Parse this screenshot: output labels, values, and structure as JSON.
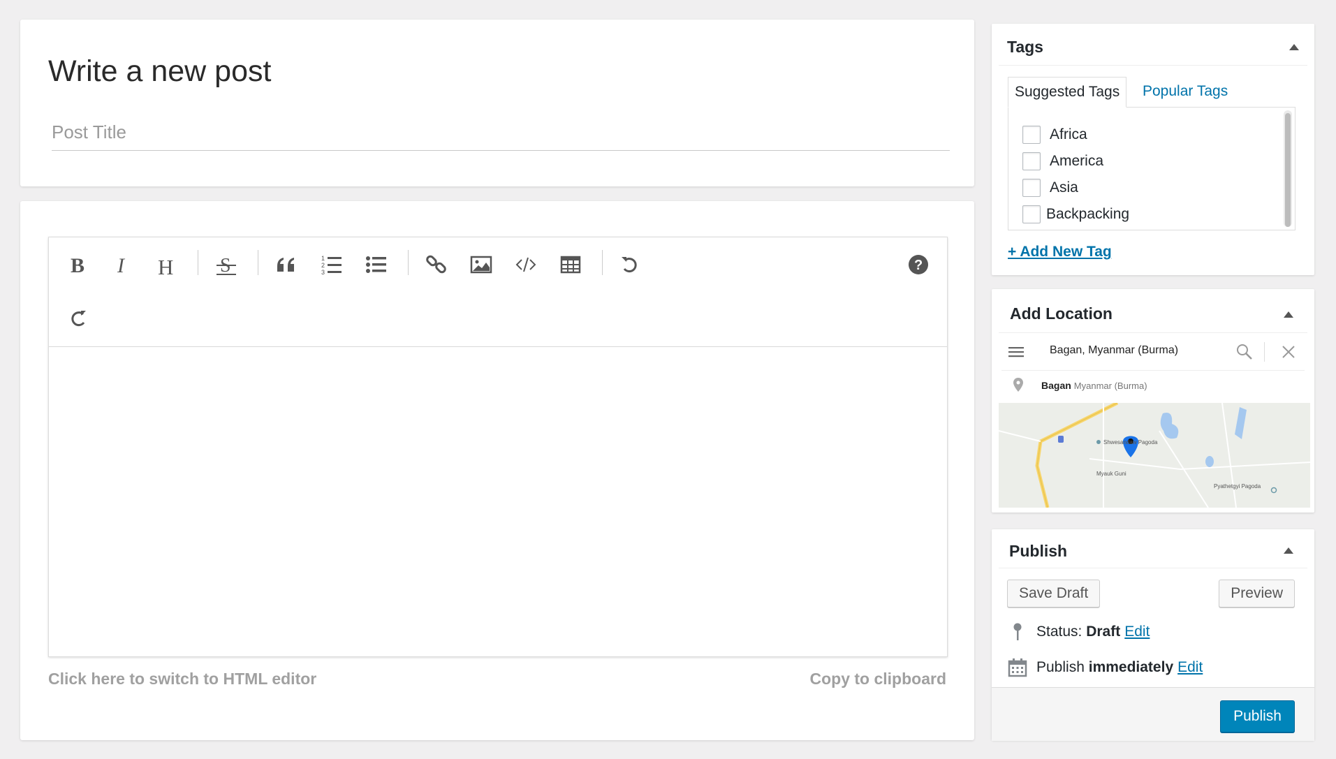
{
  "post": {
    "heading": "Write a new post",
    "title_placeholder": "Post Title",
    "title_value": ""
  },
  "editor": {
    "toolbar_icons": [
      "bold-icon",
      "italic-icon",
      "heading-icon",
      "strikethrough-icon",
      "quote-icon",
      "ordered-list-icon",
      "unordered-list-icon",
      "link-icon",
      "image-icon",
      "code-icon",
      "table-icon",
      "undo-icon",
      "redo-icon",
      "help-icon"
    ],
    "switch_html_label": "Click here to switch to HTML editor",
    "copy_label": "Copy to clipboard"
  },
  "tags_box": {
    "title": "Tags",
    "tabs": [
      {
        "label": "Suggested Tags"
      },
      {
        "label": "Popular Tags"
      }
    ],
    "tags": [
      {
        "label": "Africa",
        "checked": false
      },
      {
        "label": "America",
        "checked": false
      },
      {
        "label": "Asia",
        "checked": false
      },
      {
        "label": "Backpacking",
        "checked": false
      }
    ],
    "add_new_label": "+ Add New Tag"
  },
  "location_box": {
    "title": "Add Location",
    "search_value": "Bagan, Myanmar (Burma)",
    "suggestion": {
      "name": "Bagan",
      "region": "Myanmar (Burma)"
    },
    "map_labels": [
      "Shwesandaw Pagoda",
      "Myauk Guni",
      "Pyathetgyi Pagoda"
    ]
  },
  "publish_box": {
    "title": "Publish",
    "save_draft_label": "Save Draft",
    "preview_label": "Preview",
    "status_label": "Status:",
    "status_value": "Draft",
    "publish_label": "Publish",
    "publish_when": "immediately",
    "edit_label": "Edit",
    "publish_button_label": "Publish"
  },
  "colors": {
    "accent": "#0073aa",
    "primary_button": "#0085ba",
    "map_pin": "#1a73e8"
  }
}
